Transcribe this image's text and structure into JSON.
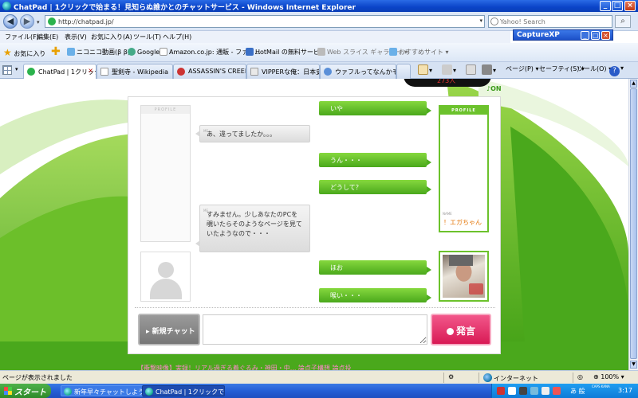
{
  "window": {
    "title": "ChatPad | 1クリックで始まる！見知らぬ誰かとのチャットサービス - Windows Internet Explorer",
    "min": "_",
    "max": "□",
    "close": "×"
  },
  "address": {
    "url": "http://chatpad.jp/",
    "search_placeholder": "Yahoo! Search"
  },
  "capture": {
    "title": "CaptureXP"
  },
  "menu": [
    "ファイル(F)",
    "編集(E)",
    "表示(V)",
    "お気に入り(A)",
    "ツール(T)",
    "ヘルプ(H)"
  ],
  "favorites": {
    "label": "お気に入り",
    "items": [
      "ニコニコ動画(β β)",
      "Google",
      "Amazon.co.jp: 通販 - ファッ...",
      "HotMail の無料サービス",
      "Web スライス ギャラリー ▾",
      "おすすめサイト ▾"
    ]
  },
  "tabs": [
    {
      "label": "ChatPad | 1クリック...",
      "active": true
    },
    {
      "label": "聖剣寺 - Wikipedia",
      "active": false
    },
    {
      "label": "ASSASSIN'S CREED I...",
      "active": false
    },
    {
      "label": "VIPPERな俺：日本史...",
      "active": false
    },
    {
      "label": "ウァフルってなんかモッサリ...",
      "active": false
    }
  ],
  "commands": {
    "page": "ページ(P) ▾",
    "safety": "セーフティ(S) ▾",
    "tools": "ツール(O) ▾"
  },
  "page": {
    "counter": "273人",
    "sound": "♪ON",
    "profile_left_header": "PROFILE",
    "profile_right_header": "PROFILE",
    "partner_name_tag": "NAME",
    "partner_name": "！エガちゃん",
    "bottom_link": "【衝撃映像】実録！リアル過ぎる着ぐるみ・神田・中... 論点子構想 論点投"
  },
  "messages": [
    {
      "side": "right",
      "text": "いや"
    },
    {
      "side": "left",
      "text": "あ、違ってましたか。。。"
    },
    {
      "side": "right",
      "text": "うん・・・"
    },
    {
      "side": "right",
      "text": "どうして？"
    },
    {
      "side": "left",
      "text": "すみません。少しあなたのPCを覗いたらそのようなページを見ていたようなので・・・"
    },
    {
      "side": "right",
      "text": "ほお"
    },
    {
      "side": "right",
      "text": "喉い・・・"
    }
  ],
  "controls": {
    "new_chat": "新規チャット",
    "send": "発言"
  },
  "status": {
    "text": "ページが表示されました",
    "zone": "インターネット",
    "zoom": "100%"
  },
  "taskbar": {
    "start": "スタート",
    "tasks": [
      "新年早々チャットしよう...",
      "ChatPad | 1クリックで..."
    ],
    "ime": "あ 般",
    "caps": "CAPS KANA",
    "clock": "3:17"
  },
  "colors": {
    "accent_green": "#6cc22c",
    "send_pink": "#e0245e",
    "titlebar_blue": "#0a44c8"
  }
}
